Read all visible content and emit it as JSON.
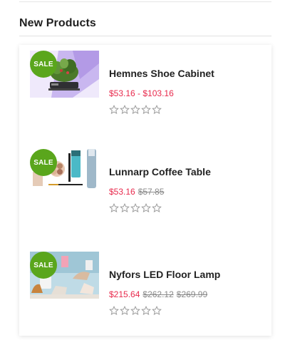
{
  "widget": {
    "title": "New Products"
  },
  "products": [
    {
      "badge": "SALE",
      "name": "Hemnes Shoe Cabinet",
      "price_from": "$53.16",
      "price_sep": " - ",
      "price_to": "$103.16",
      "image_icon": "indoor-garden-image",
      "rating": 0
    },
    {
      "badge": "SALE",
      "name": "Lunnarp Coffee Table",
      "price_now": "$53.16",
      "price_old": "$57.85",
      "image_icon": "cosmetics-image",
      "rating": 0
    },
    {
      "badge": "SALE",
      "name": "Nyfors LED Floor Lamp",
      "price_now": "$215.64",
      "price_old_1": "$262.12",
      "price_old_2": "$269.99",
      "image_icon": "shoes-bags-image",
      "rating": 0
    }
  ],
  "colors": {
    "sale_badge": "#5aa61c",
    "price_current": "#e8294c",
    "price_old": "#8a8a8a",
    "star_outline": "#9a9a9a"
  }
}
